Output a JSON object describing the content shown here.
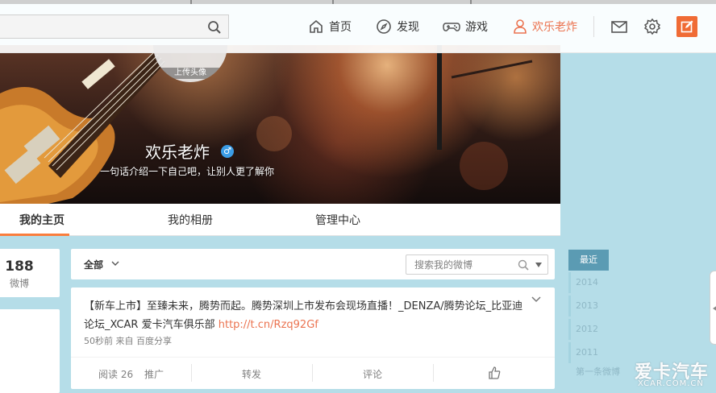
{
  "nav": {
    "search_placeholder": "",
    "items": [
      {
        "label": "首页",
        "icon": "home-icon"
      },
      {
        "label": "发现",
        "icon": "compass-icon"
      },
      {
        "label": "游戏",
        "icon": "gamepad-icon"
      },
      {
        "label": "欢乐老炸",
        "icon": "user-icon"
      }
    ],
    "icons": [
      "mail-icon",
      "gear-icon",
      "compose-icon"
    ],
    "accent": "#eb7350"
  },
  "profile": {
    "avatar_label": "上传头像",
    "name": "欢乐老炸",
    "gender_symbol": "♂",
    "intro": "一句话介绍一下自己吧，让别人更了解你"
  },
  "tabs": [
    "我的主页",
    "我的相册",
    "管理中心"
  ],
  "stats": {
    "count": "188",
    "label": "微博"
  },
  "filter": {
    "selected": "全部",
    "search_placeholder": "搜索我的微博"
  },
  "post": {
    "text": "【新车上市】至臻未来，腾势而起。腾势深圳上市发布会现场直播！_DENZA/腾势论坛_比亚迪论坛_XCAR 爱卡汽车俱乐部 ",
    "link": "http://t.cn/Rzq92Gf",
    "meta": "50秒前 来自 百度分享",
    "actions": {
      "read": "阅读 26",
      "promote": "推广",
      "repost": "转发",
      "comment": "评论"
    }
  },
  "timeline": {
    "latest": "最近",
    "years": [
      "2014",
      "2013",
      "2012",
      "2011"
    ],
    "first": "第一条微博"
  },
  "watermark": {
    "main": "爱卡汽车",
    "sub": "XCAR.COM.CN"
  }
}
